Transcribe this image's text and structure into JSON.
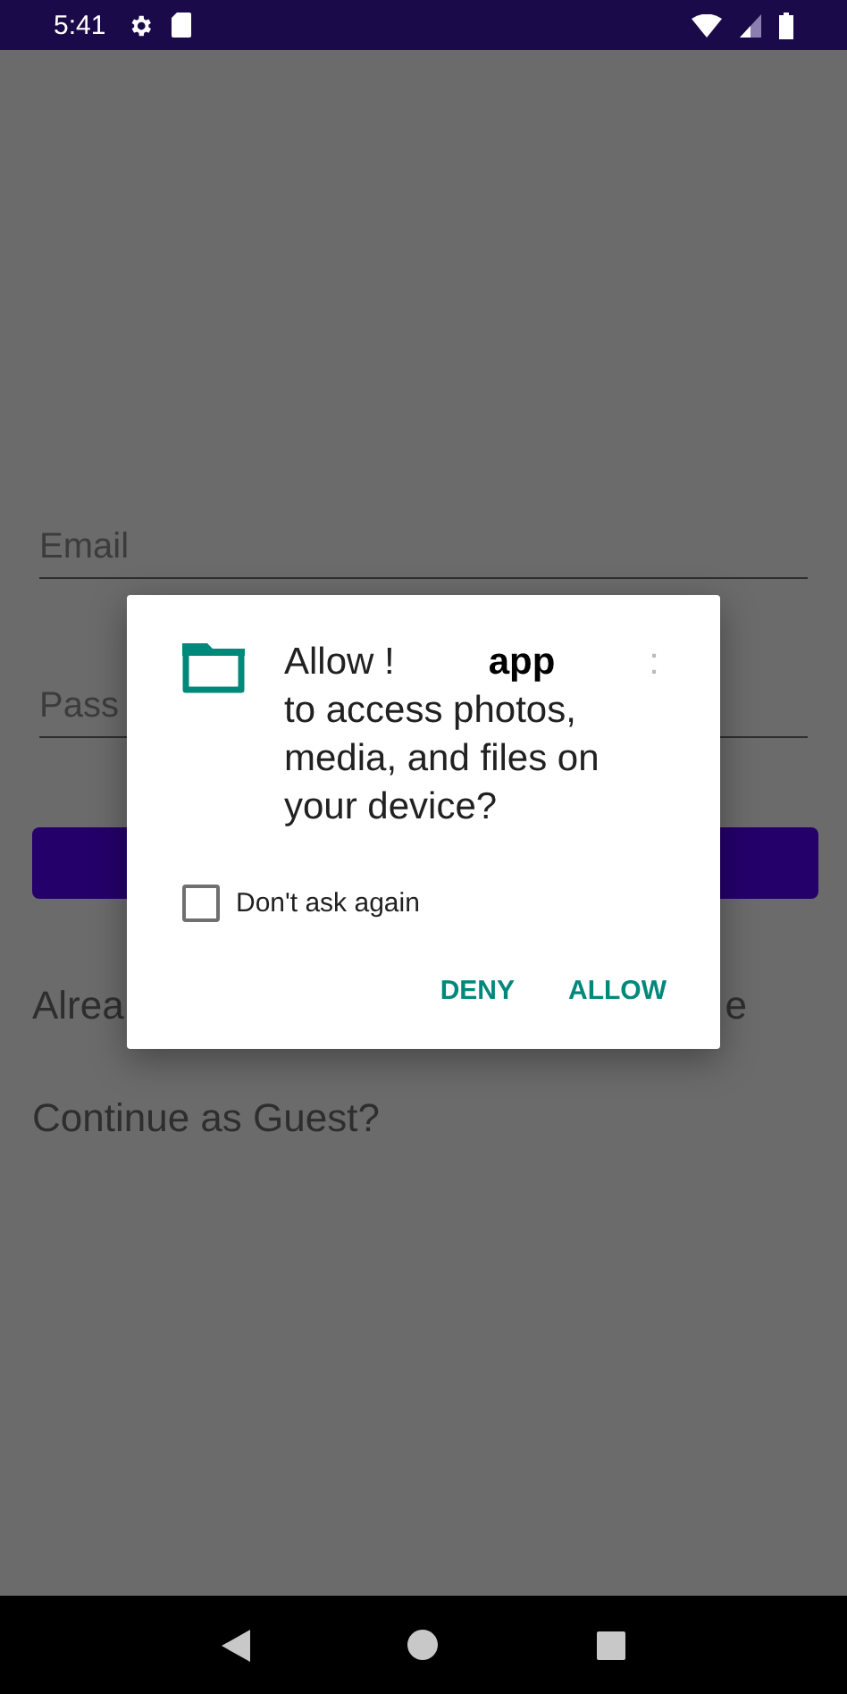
{
  "status_bar": {
    "time": "5:41"
  },
  "login": {
    "email_field": {
      "placeholder": "Email"
    },
    "password_field": {
      "placeholder": "Pass"
    },
    "prompt_fragments": [
      "Alrea",
      "e"
    ],
    "guest_link": "Continue as Guest?"
  },
  "dialog": {
    "title_fragments": [
      {
        "text": "Allow !",
        "bold": false
      },
      {
        "text": "app",
        "bold": true
      },
      {
        "text": ":",
        "bold": false
      }
    ],
    "message": "to access photos, media, and files on your device?",
    "checkbox": {
      "label": "Don't ask again",
      "checked": false
    },
    "buttons": [
      "DENY",
      "ALLOW"
    ]
  }
}
